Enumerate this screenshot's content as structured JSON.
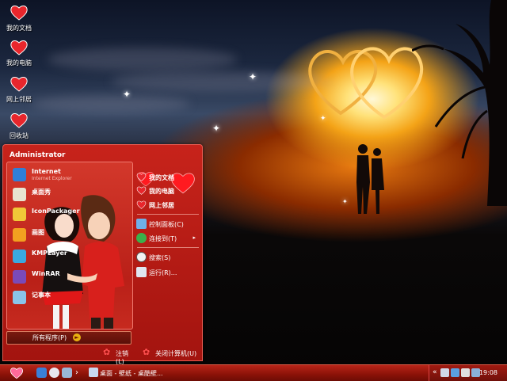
{
  "desktop_icons": [
    {
      "label": "我的文档",
      "icon": "heart-icon"
    },
    {
      "label": "我的电脑",
      "icon": "heart-icon"
    },
    {
      "label": "网上邻居",
      "icon": "heart-icon"
    },
    {
      "label": "回收站",
      "icon": "heart-icon"
    }
  ],
  "start_menu": {
    "user": "Administrator",
    "programs": [
      {
        "title": "Internet",
        "subtitle": "Internet Explorer",
        "icon": "ie-icon"
      },
      {
        "title": "桌面秀",
        "subtitle": "",
        "icon": "app-icon"
      },
      {
        "title": "IconPackager",
        "subtitle": "",
        "icon": "iconpackager-icon"
      },
      {
        "title": "画图",
        "subtitle": "",
        "icon": "paint-icon"
      },
      {
        "title": "KMPLayer",
        "subtitle": "",
        "icon": "kmplayer-icon"
      },
      {
        "title": "WinRAR",
        "subtitle": "",
        "icon": "winrar-icon"
      },
      {
        "title": "记事本",
        "subtitle": "",
        "icon": "notepad-icon"
      }
    ],
    "all_programs": "所有程序(P)",
    "right_items": [
      {
        "label": "我的文档",
        "icon": "heart-icon"
      },
      {
        "label": "我的电脑",
        "icon": "heart-icon"
      },
      {
        "label": "网上邻居",
        "icon": "heart-icon"
      },
      {
        "label": "控制面板(C)",
        "icon": "control-panel-icon"
      },
      {
        "label": "连接到(T)",
        "icon": "connect-icon",
        "submenu": "▸"
      },
      {
        "label": "搜索(S)",
        "icon": "search-icon"
      },
      {
        "label": "运行(R)...",
        "icon": "run-icon"
      }
    ],
    "logoff": "注销(L)",
    "shutdown": "关闭计算机(U)"
  },
  "taskbar": {
    "tasks": [
      {
        "label": "桌面 - 壁纸 - 桌酷壁...",
        "icon": "window-icon"
      }
    ],
    "clock": "19:08",
    "chevron": "›",
    "tray_chevron": "«"
  },
  "colors": {
    "accent": "#c7231b",
    "heart": "#e8262c"
  }
}
